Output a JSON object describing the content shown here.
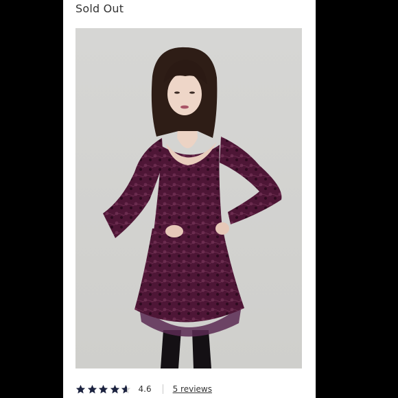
{
  "listing": {
    "status_label": "Sold Out",
    "photo": {
      "subject": "model wearing long-sleeve plum lace skater dress with tulle underlayer"
    }
  },
  "rating": {
    "value": "4.6",
    "score": 4.6,
    "max": 5,
    "reviews_label": "5 reviews",
    "star_color": "#1c2340",
    "star_empty_color": "#d0d0d0"
  },
  "colors": {
    "page_background": "#ffffff",
    "surround": "#000000",
    "text": "#333333",
    "dress": "#4e1636"
  }
}
